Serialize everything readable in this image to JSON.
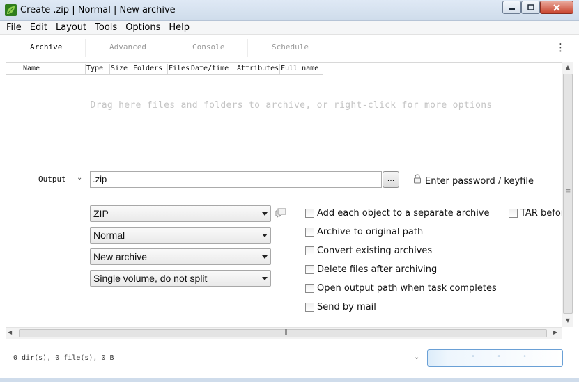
{
  "window": {
    "title": "Create .zip | Normal | New archive"
  },
  "menu": [
    "File",
    "Edit",
    "Layout",
    "Tools",
    "Options",
    "Help"
  ],
  "tabs": {
    "archive": "Archive",
    "advanced": "Advanced",
    "console": "Console",
    "schedule": "Schedule",
    "active": "Archive"
  },
  "filelist": {
    "columns": [
      "Name",
      "Type",
      "Size",
      "Folders",
      "Files",
      "Date/time",
      "Attributes",
      "Full name"
    ],
    "empty_hint": "Drag here files and folders to archive, or right-click for more options"
  },
  "output": {
    "label": "Output",
    "value": ".zip",
    "browse_label": "...",
    "password_label": "Enter password / keyfile"
  },
  "options": {
    "format": "ZIP",
    "level": "Normal",
    "mode": "New archive",
    "split": "Single volume, do not split"
  },
  "checkboxes": {
    "separate_archive": "Add each object to a separate archive",
    "original_path": "Archive to original path",
    "convert_existing": "Convert existing archives",
    "delete_after": "Delete files after archiving",
    "open_output": "Open output path when task completes",
    "send_mail": "Send by mail",
    "tar_before": "TAR befor"
  },
  "status": {
    "summary": "0 dir(s), 0 file(s), 0 B"
  },
  "icons": {
    "app": "leaf-icon",
    "lock": "lock-icon",
    "comment": "comment-icon",
    "more": "kebab-menu-icon"
  },
  "colors": {
    "titlebar": "#dfe9f5",
    "hint_text": "#c4c4c4",
    "action_border": "#6aa0d6"
  }
}
